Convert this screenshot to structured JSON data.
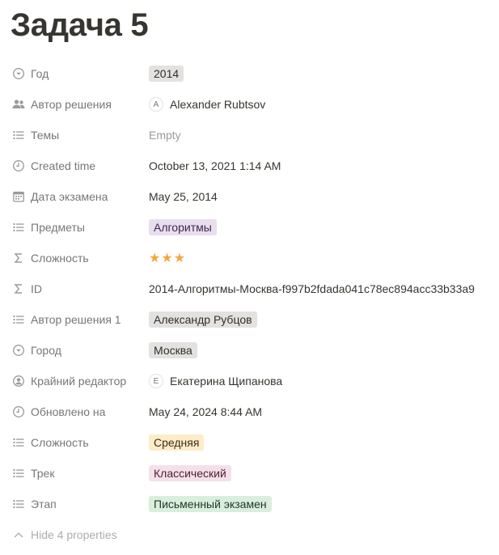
{
  "page": {
    "title": "Задача 5"
  },
  "properties": [
    {
      "name": "Год",
      "icon": "select-icon",
      "type": "tag",
      "color": "gray",
      "value": "2014"
    },
    {
      "name": "Автор решения",
      "icon": "people-icon",
      "type": "person",
      "initial": "A",
      "value": "Alexander Rubtsov"
    },
    {
      "name": "Темы",
      "icon": "list-icon",
      "type": "empty",
      "value": "Empty"
    },
    {
      "name": "Created time",
      "icon": "clock-icon",
      "type": "text",
      "value": "October 13, 2021 1:14 AM"
    },
    {
      "name": "Дата экзамена",
      "icon": "calendar-icon",
      "type": "text",
      "value": "May 25, 2014"
    },
    {
      "name": "Предметы",
      "icon": "list-icon",
      "type": "tag",
      "color": "purple",
      "value": "Алгоритмы"
    },
    {
      "name": "Сложность",
      "icon": "sigma-icon",
      "type": "stars",
      "value": "★★★"
    },
    {
      "name": "ID",
      "icon": "sigma-icon",
      "type": "text",
      "value": "2014-Алгоритмы-Москва-f997b2fdada041c78ec894acc33b33a9"
    },
    {
      "name": "Автор решения 1",
      "icon": "list-icon",
      "type": "tag",
      "color": "gray",
      "value": "Александр Рубцов"
    },
    {
      "name": "Город",
      "icon": "select-icon",
      "type": "tag",
      "color": "gray",
      "value": "Москва"
    },
    {
      "name": "Крайний редактор",
      "icon": "person-circle-icon",
      "type": "person",
      "initial": "E",
      "value": "Екатерина Щипанова"
    },
    {
      "name": "Обновлено на",
      "icon": "clock-icon",
      "type": "text",
      "value": "May 24, 2024 8:44 AM"
    },
    {
      "name": "Сложность",
      "icon": "list-icon",
      "type": "tag",
      "color": "yellow",
      "value": "Средняя"
    },
    {
      "name": "Трек",
      "icon": "list-icon",
      "type": "tag",
      "color": "pink",
      "value": "Классический"
    },
    {
      "name": "Этап",
      "icon": "list-icon",
      "type": "tag",
      "color": "green",
      "value": "Письменный экзамен"
    }
  ],
  "footer": {
    "hide_label": "Hide 4 properties",
    "icon": "chevron-up-icon"
  },
  "colors": {
    "star": "#f2a93b",
    "label": "#787774",
    "text": "#37352f"
  }
}
